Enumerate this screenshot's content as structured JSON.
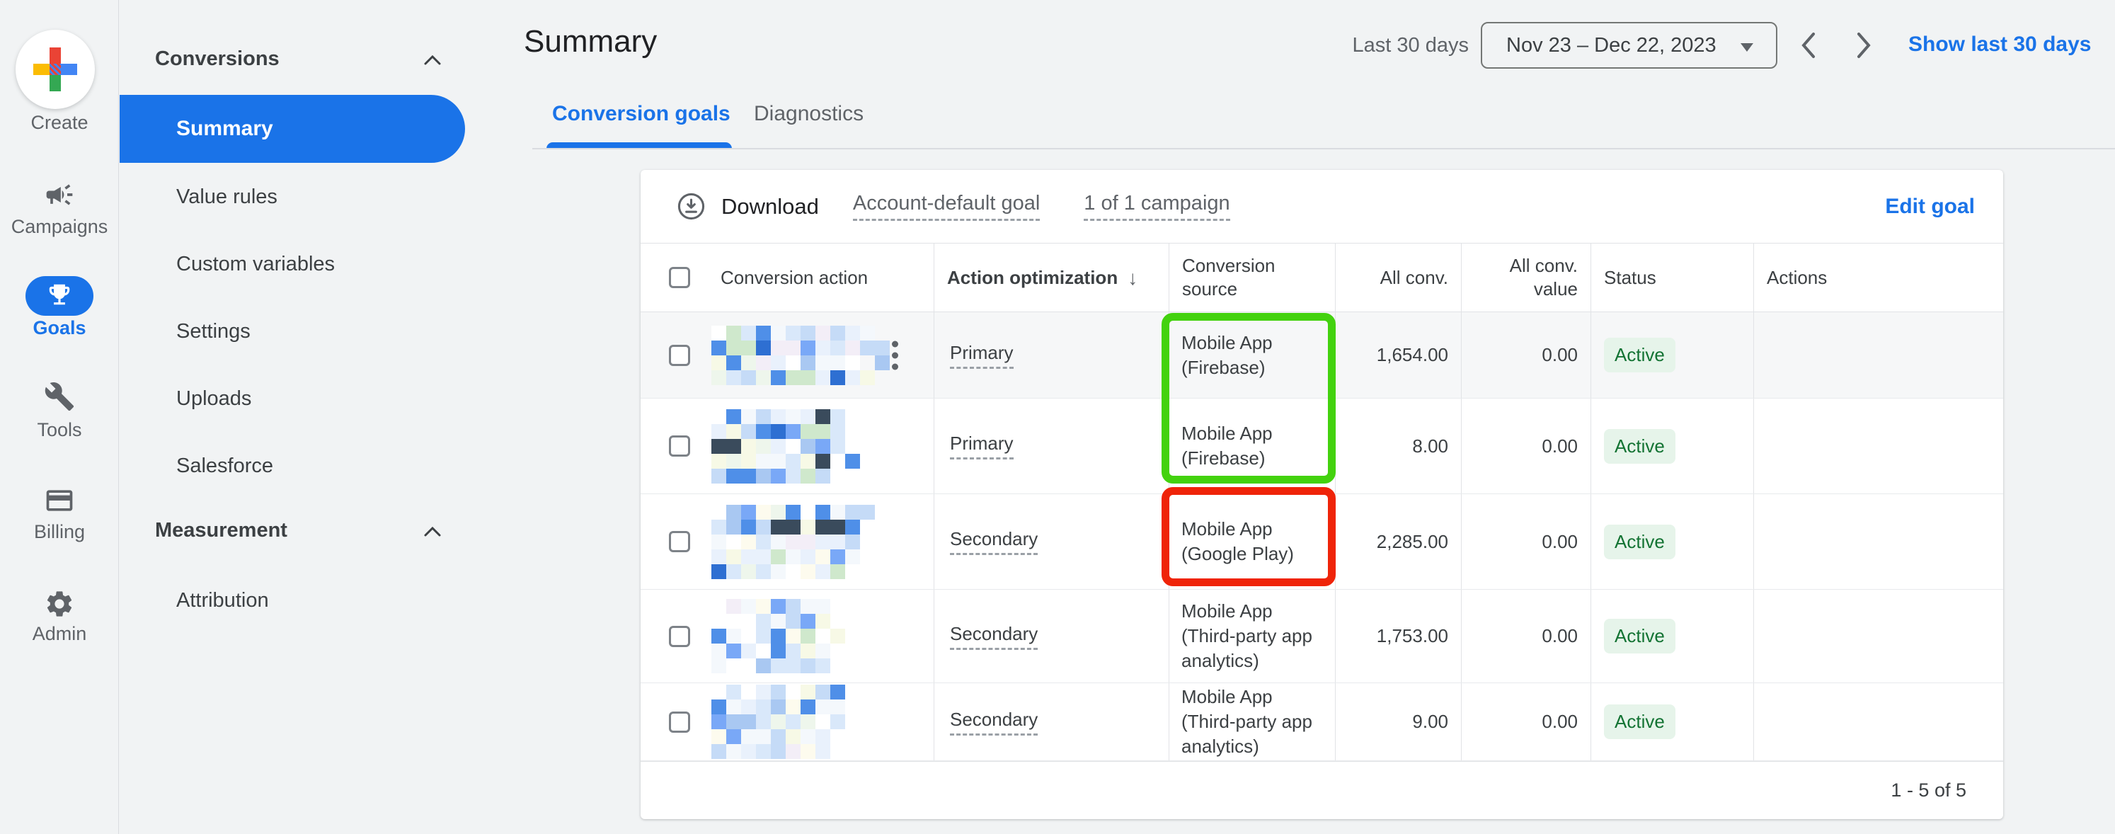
{
  "app": {
    "background": "#f1f3f4",
    "accent": "#1a73e8"
  },
  "left_rail": {
    "create": {
      "label": "Create",
      "icon": "google-plus-icon"
    },
    "items": [
      {
        "label": "Campaigns",
        "icon": "megaphone-icon",
        "active": false
      },
      {
        "label": "Goals",
        "icon": "trophy-icon",
        "active": true
      },
      {
        "label": "Tools",
        "icon": "wrench-icon",
        "active": false
      },
      {
        "label": "Billing",
        "icon": "credit-card-icon",
        "active": false
      },
      {
        "label": "Admin",
        "icon": "gear-icon",
        "active": false
      }
    ]
  },
  "sidebar": {
    "sections": [
      {
        "label": "Conversions",
        "collapsed": false,
        "items": [
          {
            "label": "Summary",
            "selected": true
          },
          {
            "label": "Value rules",
            "selected": false
          },
          {
            "label": "Custom variables",
            "selected": false
          },
          {
            "label": "Settings",
            "selected": false
          },
          {
            "label": "Uploads",
            "selected": false
          },
          {
            "label": "Salesforce",
            "selected": false
          }
        ]
      },
      {
        "label": "Measurement",
        "collapsed": false,
        "items": [
          {
            "label": "Attribution",
            "selected": false
          }
        ]
      }
    ]
  },
  "header": {
    "title": "Summary",
    "date_preset_label": "Last 30 days",
    "date_range": "Nov 23 – Dec 22, 2023",
    "show_last_30_days_link": "Show last 30 days"
  },
  "tabs": [
    {
      "label": "Conversion goals",
      "selected": true
    },
    {
      "label": "Diagnostics",
      "selected": false
    }
  ],
  "toolbar": {
    "download_label": "Download",
    "goal_filter": "Account-default goal",
    "campaign_filter": "1 of 1 campaign",
    "edit_goal_label": "Edit goal"
  },
  "table": {
    "columns": [
      "Conversion action",
      "Action optimization",
      "Conversion source",
      "All conv.",
      "All conv. value",
      "Status",
      "Actions"
    ],
    "sorted_column": "Action optimization",
    "sort_direction": "descending",
    "sort_arrow": "↓",
    "rows": [
      {
        "action_redacted": true,
        "optimization": "Primary",
        "source": "Mobile App (Firebase)",
        "all_conv": "1,654.00",
        "all_conv_value": "0.00",
        "status": "Active",
        "menu": true,
        "highlight": "green"
      },
      {
        "action_redacted": true,
        "optimization": "Primary",
        "source": "Mobile App (Firebase)",
        "all_conv": "8.00",
        "all_conv_value": "0.00",
        "status": "Active",
        "menu": false,
        "highlight": "green"
      },
      {
        "action_redacted": true,
        "optimization": "Secondary",
        "source": "Mobile App (Google Play)",
        "all_conv": "2,285.00",
        "all_conv_value": "0.00",
        "status": "Active",
        "menu": false,
        "highlight": "red"
      },
      {
        "action_redacted": true,
        "optimization": "Secondary",
        "source": "Mobile App (Third-party app analytics)",
        "all_conv": "1,753.00",
        "all_conv_value": "0.00",
        "status": "Active",
        "menu": false,
        "highlight": "none"
      },
      {
        "action_redacted": true,
        "optimization": "Secondary",
        "source": "Mobile App (Third-party app analytics)",
        "all_conv": "9.00",
        "all_conv_value": "0.00",
        "status": "Active",
        "menu": false,
        "highlight": "none"
      }
    ],
    "pagination": "1 - 5 of 5"
  },
  "annotations": {
    "green_box_color": "#43d20e",
    "red_box_color": "#ef2409"
  },
  "status_colors": {
    "active_bg": "#e6f4ea",
    "active_text": "#137333"
  },
  "redaction": {
    "tile": 21,
    "palette": [
      "#ffffff",
      "#f4f8fc",
      "#e9f1fc",
      "#eef6ec",
      "#f7f9e6",
      "#fdfbee",
      "#d9e8fa",
      "#c5dbf7",
      "#a9c8f2",
      "#79a8f7",
      "#4f8fe8",
      "#2e6fd2",
      "#3a4b5c",
      "#cfe8cc",
      "#f3eef7"
    ],
    "weights": [
      14,
      13,
      12,
      7,
      7,
      6,
      8,
      7,
      5,
      5,
      4,
      2,
      1,
      3,
      4
    ],
    "rows": [
      {
        "cols": 12,
        "rows": 4,
        "seed": 11
      },
      {
        "cols": 10,
        "rows": 5,
        "seed": 22
      },
      {
        "cols": 11,
        "rows": 5,
        "seed": 33
      },
      {
        "cols": 9,
        "rows": 5,
        "seed": 47
      },
      {
        "cols": 9,
        "rows": 5,
        "seed": 55
      }
    ]
  }
}
